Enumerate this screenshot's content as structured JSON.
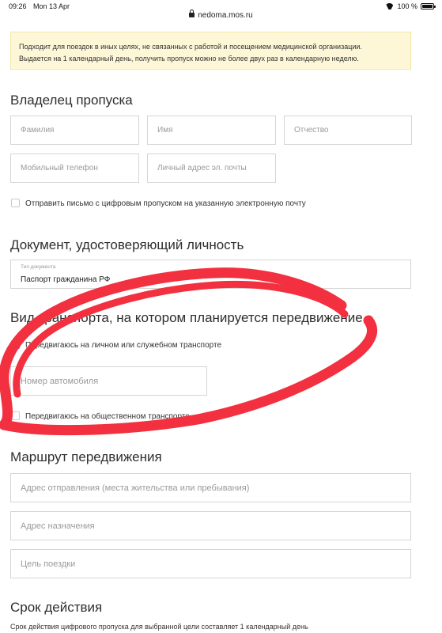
{
  "status_bar": {
    "time": "09:26",
    "date": "Mon 13 Apr",
    "url": "nedoma.mos.ru",
    "battery": "100 %"
  },
  "notice": {
    "line1": "Подходит для поездок в иных целях, не связанных с работой и посещением медицинской организации.",
    "line2": "Выдается на 1 календарный день, получить пропуск можно не более двух раз в календарную неделю."
  },
  "owner": {
    "title": "Владелец пропуска",
    "surname_placeholder": "Фамилия",
    "name_placeholder": "Имя",
    "patronymic_placeholder": "Отчество",
    "phone_placeholder": "Мобильный телефон",
    "email_placeholder": "Личный адрес эл. почты",
    "send_email_label": "Отправить письмо с цифровым пропуском на указанную электронную почту",
    "send_email_checked": false
  },
  "document": {
    "title": "Документ, удостоверяющий личность",
    "type_caption": "Тип документа",
    "type_value": "Паспорт гражданина РФ"
  },
  "transport": {
    "title": "Вид транспорта, на котором планируется передвижение",
    "personal_label": "Передвигаюсь на личном или служебном транспорте",
    "personal_checked": true,
    "car_number_placeholder": "Номер автомобиля",
    "public_label": "Передвигаюсь на общественном транспорте",
    "public_checked": false
  },
  "route": {
    "title": "Маршрут передвижения",
    "departure_placeholder": "Адрес отправления (места жительства или пребывания)",
    "destination_placeholder": "Адрес назначения",
    "purpose_placeholder": "Цель поездки"
  },
  "validity": {
    "title": "Срок действия",
    "note": "Срок действия цифрового пропуска для выбранной цели составляет 1 календарный день"
  },
  "colors": {
    "accent": "#2f7ad8",
    "notice_bg": "#fdf7d8",
    "annotation": "#f2303f"
  }
}
